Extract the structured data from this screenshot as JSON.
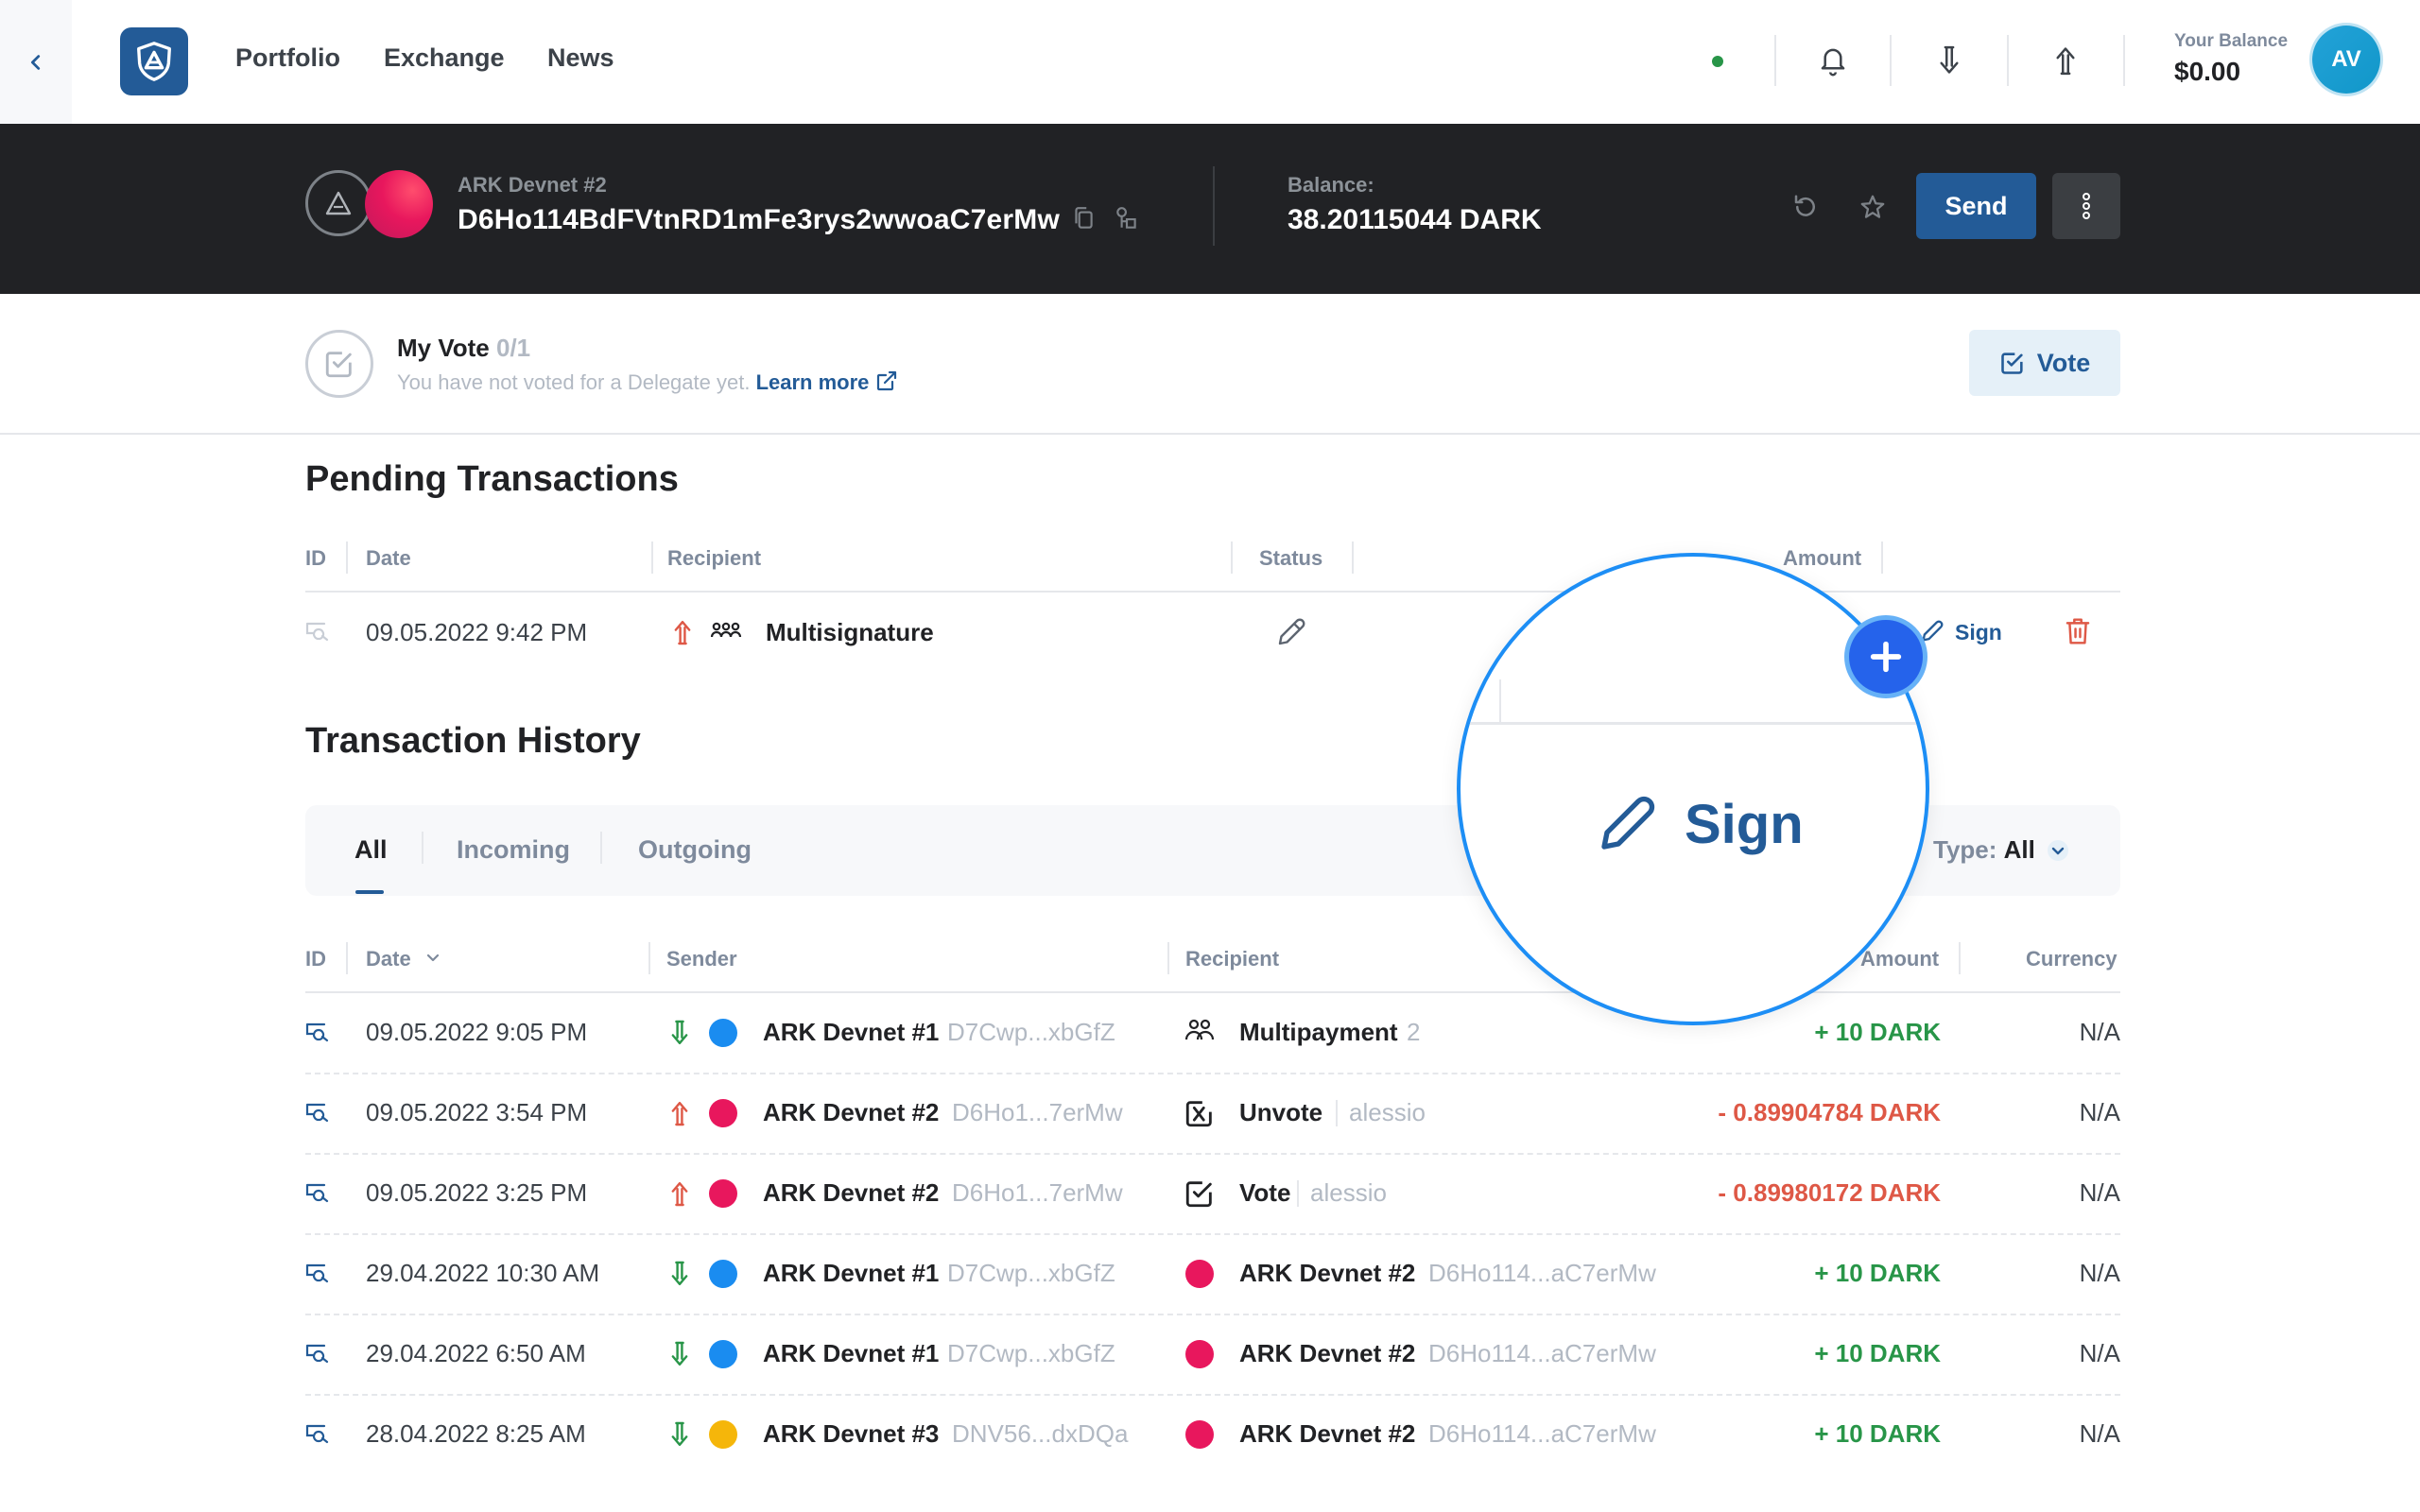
{
  "nav": {
    "links": [
      "Portfolio",
      "Exchange",
      "News"
    ],
    "balance_label": "Your Balance",
    "balance_value": "$0.00",
    "avatar_initials": "AV"
  },
  "wallet": {
    "name": "ARK Devnet #2",
    "address": "D6Ho114BdFVtnRD1mFe3rys2wwoaC7erMw",
    "balance_label": "Balance:",
    "balance_value": "38.20115044 DARK",
    "send_label": "Send"
  },
  "vote": {
    "title": "My Vote",
    "count": "0/1",
    "subtitle": "You have not voted for a Delegate yet.",
    "learn_more": "Learn more",
    "button_label": "Vote"
  },
  "pending": {
    "heading": "Pending Transactions",
    "columns": [
      "ID",
      "Date",
      "Recipient",
      "Status",
      "Amount"
    ],
    "row": {
      "date": "09.05.2022 9:42 PM",
      "recipient": "Multisignature",
      "sign_label": "Sign"
    }
  },
  "history": {
    "heading": "Transaction History",
    "tabs": [
      "All",
      "Incoming",
      "Outgoing"
    ],
    "type_label": "Type:",
    "type_value": "All",
    "columns": [
      "ID",
      "Date",
      "Sender",
      "Recipient",
      "Amount",
      "Currency"
    ],
    "rows": [
      {
        "date": "09.05.2022 9:05 PM",
        "direction": "incoming",
        "sender_color": "#1a8cf0",
        "sender": "ARK Devnet #1",
        "sender_addr": "D7Cwp...xbGfZ",
        "recipient_icon": "multipayment-icon",
        "recipient": "Multipayment",
        "recipient_extra": "2",
        "amount": "+ 10 DARK",
        "amount_sign": "pos",
        "currency": "N/A"
      },
      {
        "date": "09.05.2022 3:54 PM",
        "direction": "outgoing",
        "sender_color": "#e8175d",
        "sender": "ARK Devnet #2",
        "sender_addr": "D6Ho1...7erMw",
        "recipient_icon": "unvote-icon",
        "recipient": "Unvote",
        "recipient_extra": "alessio",
        "amount": "- 0.89904784 DARK",
        "amount_sign": "neg",
        "currency": "N/A"
      },
      {
        "date": "09.05.2022 3:25 PM",
        "direction": "outgoing",
        "sender_color": "#e8175d",
        "sender": "ARK Devnet #2",
        "sender_addr": "D6Ho1...7erMw",
        "recipient_icon": "vote-icon",
        "recipient": "Vote",
        "recipient_extra": "alessio",
        "amount": "- 0.89980172 DARK",
        "amount_sign": "neg",
        "currency": "N/A"
      },
      {
        "date": "29.04.2022 10:30 AM",
        "direction": "incoming",
        "sender_color": "#1a8cf0",
        "sender": "ARK Devnet #1",
        "sender_addr": "D7Cwp...xbGfZ",
        "recipient_icon": "wallet-avatar",
        "recipient_color": "#e8175d",
        "recipient": "ARK Devnet #2",
        "recipient_extra": "D6Ho114...aC7erMw",
        "amount": "+ 10 DARK",
        "amount_sign": "pos",
        "currency": "N/A"
      },
      {
        "date": "29.04.2022 6:50 AM",
        "direction": "incoming",
        "sender_color": "#1a8cf0",
        "sender": "ARK Devnet #1",
        "sender_addr": "D7Cwp...xbGfZ",
        "recipient_icon": "wallet-avatar",
        "recipient_color": "#e8175d",
        "recipient": "ARK Devnet #2",
        "recipient_extra": "D6Ho114...aC7erMw",
        "amount": "+ 10 DARK",
        "amount_sign": "pos",
        "currency": "N/A"
      },
      {
        "date": "28.04.2022 8:25 AM",
        "direction": "incoming",
        "sender_color": "#f5b60a",
        "sender": "ARK Devnet #3",
        "sender_addr": "DNV56...dxDQa",
        "recipient_icon": "wallet-avatar",
        "recipient_color": "#e8175d",
        "recipient": "ARK Devnet #2",
        "recipient_extra": "D6Ho114...aC7erMw",
        "amount": "+ 10 DARK",
        "amount_sign": "pos",
        "currency": "N/A"
      }
    ]
  },
  "magnifier": {
    "label": "Sign"
  },
  "colors": {
    "primary": "#235b97",
    "dark": "#212225",
    "positive": "#289548",
    "negative": "#de5846",
    "accent_ring": "#1d8ef5"
  }
}
